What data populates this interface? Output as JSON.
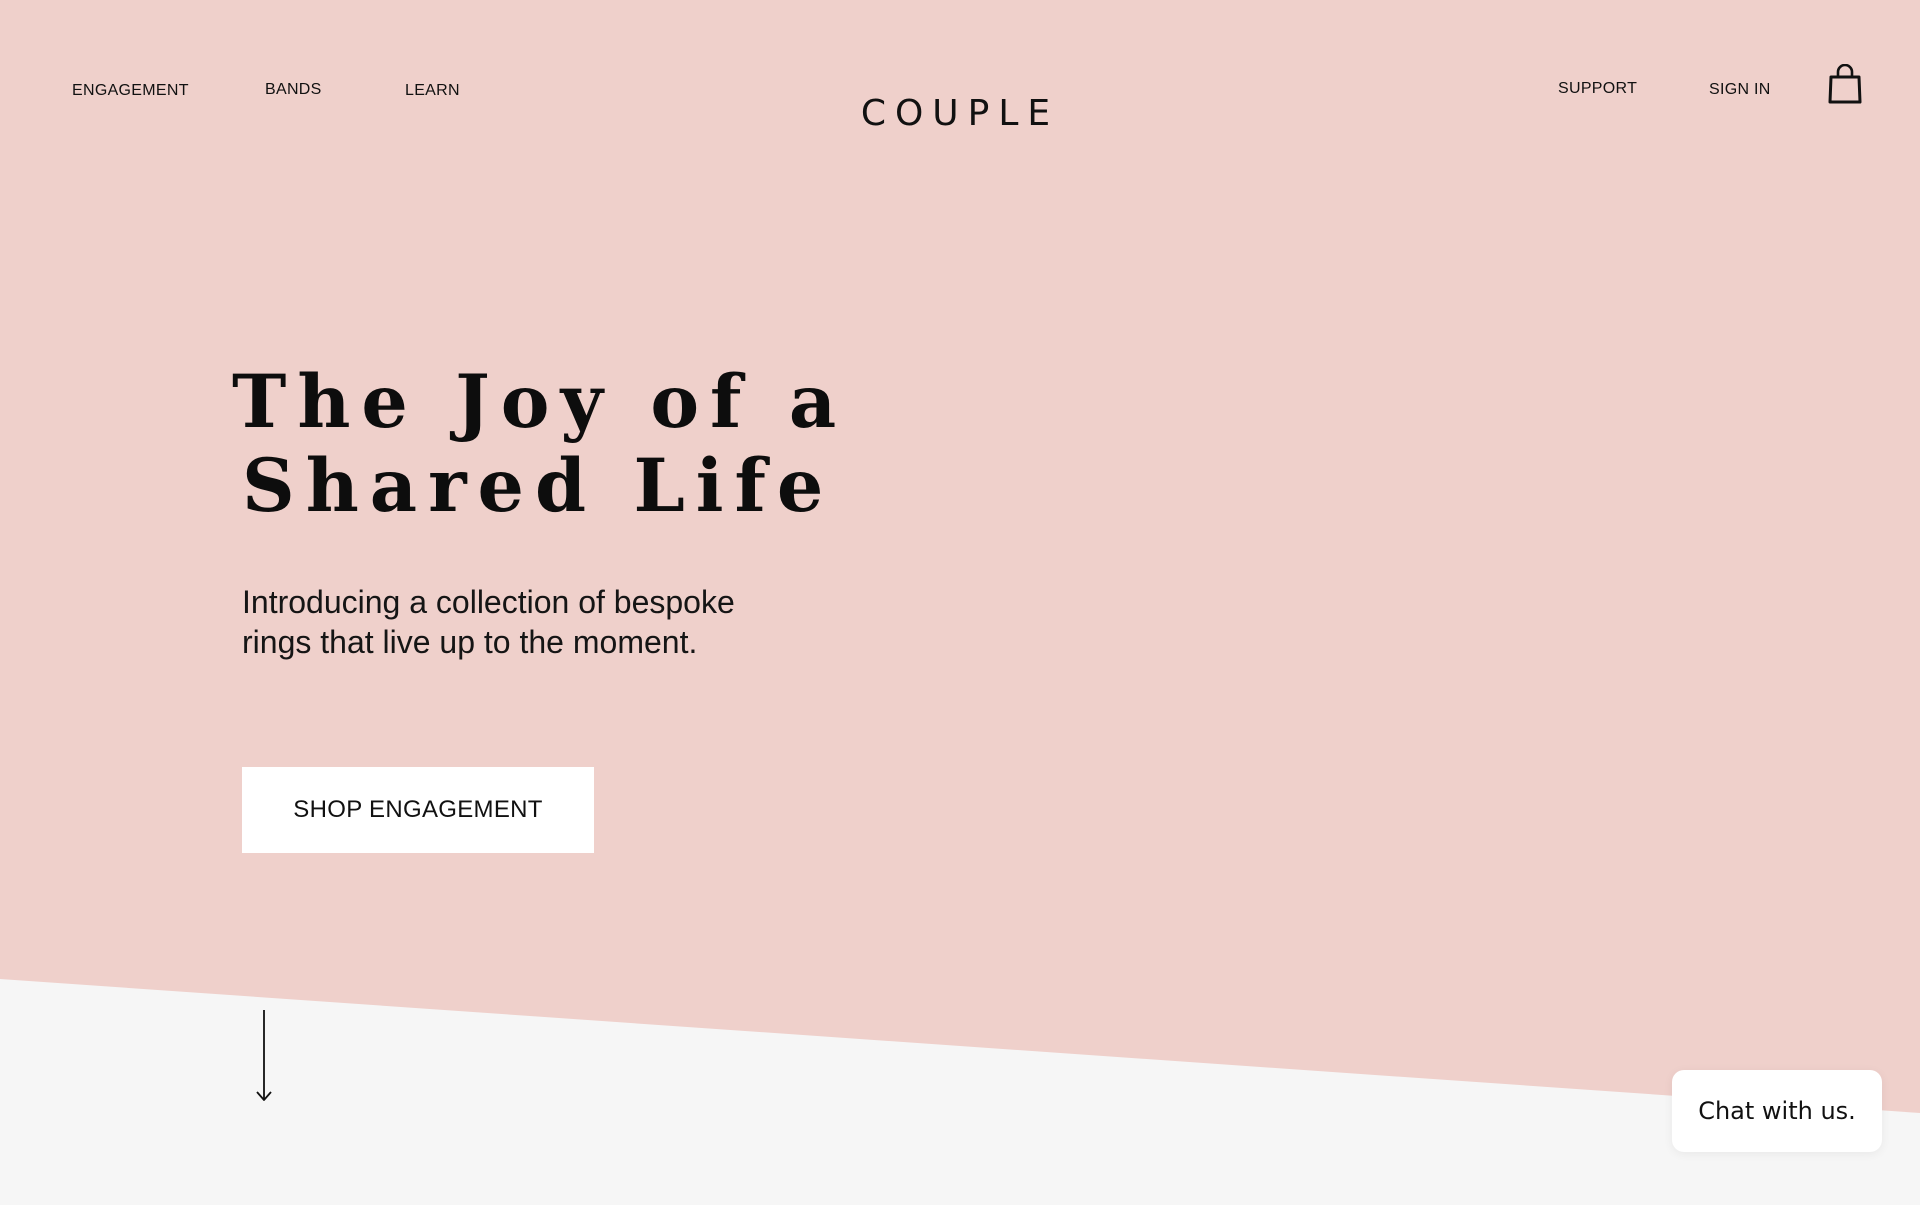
{
  "nav": {
    "left": [
      {
        "label": "ENGAGEMENT"
      },
      {
        "label": "BANDS"
      },
      {
        "label": "LEARN"
      }
    ],
    "logo": "COUPLE",
    "right": [
      {
        "label": "SUPPORT"
      },
      {
        "label": "SIGN IN"
      }
    ],
    "cart_icon": "shopping-bag-icon"
  },
  "hero": {
    "headline_line1": "The Joy of a",
    "headline_line2": "Shared Life",
    "subtitle_line1": "Introducing a collection of bespoke",
    "subtitle_line2": "rings that live up to the moment.",
    "cta_label": "SHOP ENGAGEMENT",
    "scroll_icon": "arrow-down-icon"
  },
  "chat": {
    "label": "Chat with us."
  },
  "colors": {
    "hero_pink": "#efd0cb",
    "page_bg": "#f6f6f6",
    "text": "#111111",
    "button_bg": "#ffffff"
  }
}
